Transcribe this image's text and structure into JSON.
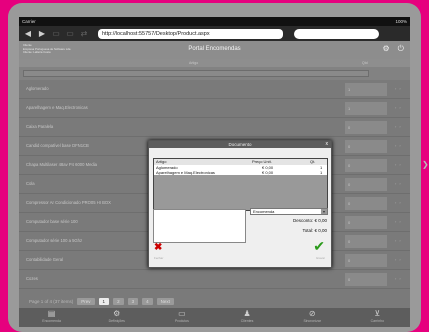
{
  "status": {
    "carrier": "Carrier",
    "battery": "100%"
  },
  "browser": {
    "url": "http://localhost:55757/Desktop/Product.aspx"
  },
  "header": {
    "title": "Portal Encomendas",
    "lines": [
      "Cliente",
      "Empresa Portuguesa de Software Lda",
      "Cliente: Lafieira Costa"
    ]
  },
  "columns": {
    "product": "Artigo",
    "qty": "Qtd"
  },
  "products": [
    {
      "name": "Aglomerado",
      "qty": "1"
    },
    {
      "name": "Aparelhagem e Maq.Electronicas",
      "qty": "1"
    },
    {
      "name": "Caixa Paralela",
      "qty": "0"
    },
    {
      "name": "Candid compatível base DFN1CB",
      "qty": "0"
    },
    {
      "name": "Chapa Multilaser 48av P4 6000 Media",
      "qty": "0"
    },
    {
      "name": "Cola",
      "qty": "0"
    },
    {
      "name": "Compressor Ar Condicionado PRO05 HI BOX",
      "qty": "0"
    },
    {
      "name": "Computador base série 100",
      "qty": "0"
    },
    {
      "name": "Computador série 100 a 5Ghz",
      "qty": "0"
    },
    {
      "name": "Contabilidade Geral",
      "qty": "0"
    },
    {
      "name": "Cozes",
      "qty": "0"
    }
  ],
  "pager": {
    "summary": "Page 1 of 4 (37 items)",
    "prev": "Prev",
    "pages": [
      "1",
      "2",
      "3",
      "4"
    ],
    "next": "Next"
  },
  "toolbar": [
    "Encomenda",
    "Definições",
    "Produtos",
    "Clientes",
    "Sincronizar",
    "Carrinho"
  ],
  "dialog": {
    "title": "Documento",
    "close": "x",
    "columns": {
      "artigo": "Artigo",
      "preco": "Preço Unit.",
      "qt": "Qt."
    },
    "lines": [
      {
        "artigo": "Aglomerado",
        "preco": "€ 0,00",
        "qt": "1"
      },
      {
        "artigo": "Aparelhagem e Maq.Electronicas",
        "preco": "€ 0,00",
        "qt": "1"
      }
    ],
    "type": "Encomenda",
    "discount": "Desconto: € 0,00",
    "total": "Total: € 0,00",
    "cancel_label": "Fechar",
    "ok_label": "Gravar"
  }
}
